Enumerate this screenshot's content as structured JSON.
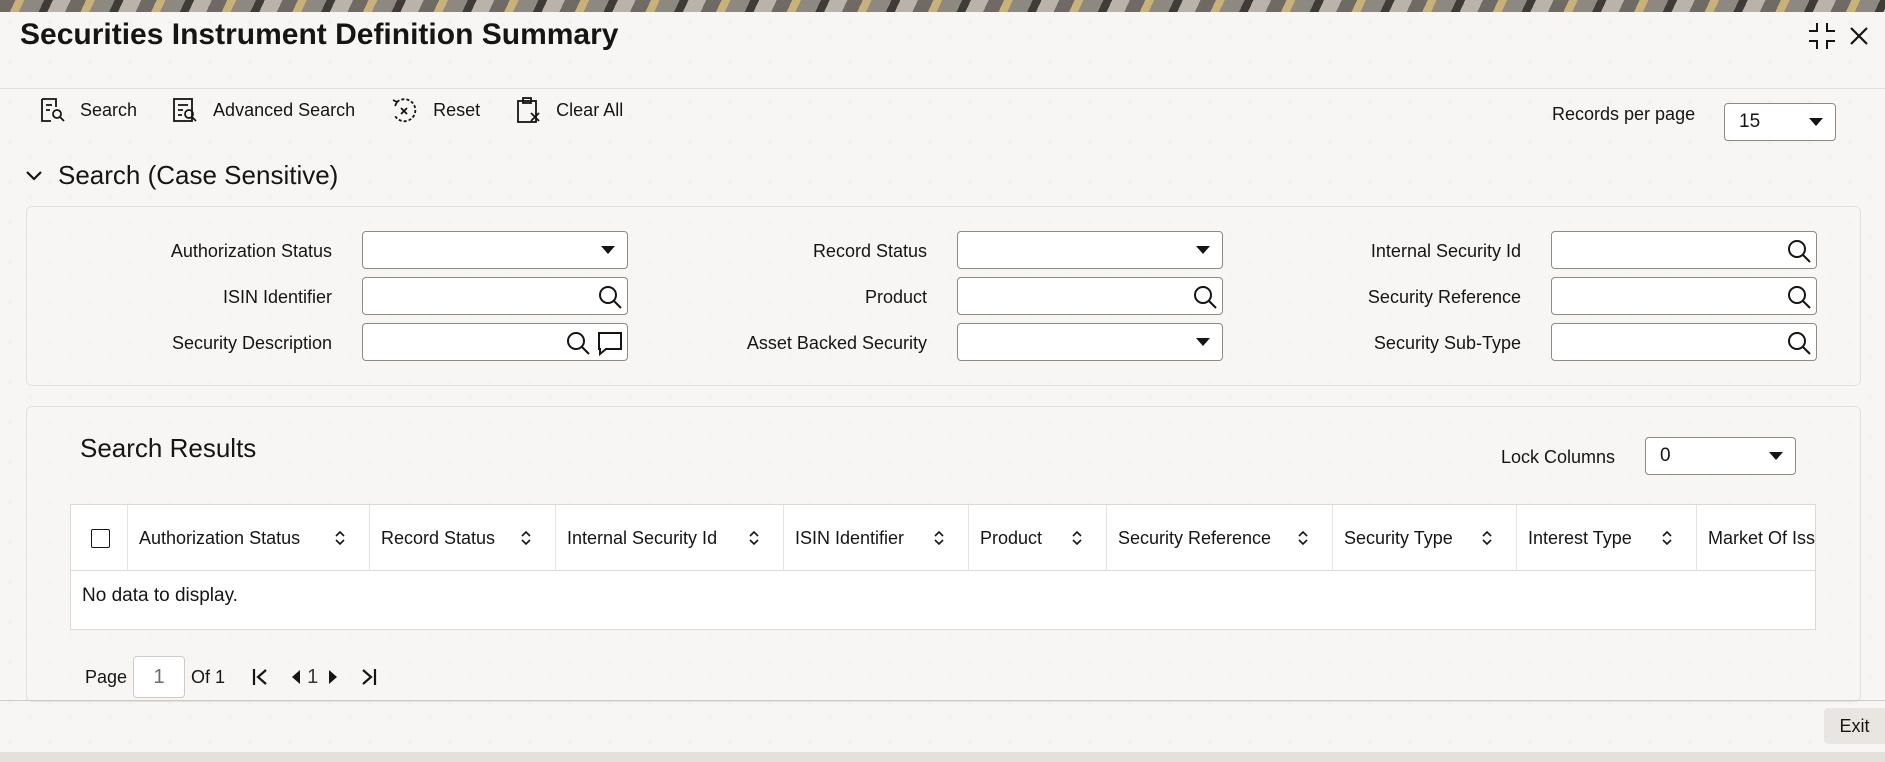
{
  "window": {
    "title": "Securities Instrument Definition Summary"
  },
  "toolbar": {
    "search_label": "Search",
    "advanced_search_label": "Advanced Search",
    "reset_label": "Reset",
    "clear_all_label": "Clear All",
    "records_per_page_label": "Records per page",
    "records_per_page_value": "15"
  },
  "search": {
    "section_title": "Search (Case Sensitive)",
    "fields": {
      "authorization_status": "Authorization Status",
      "record_status": "Record Status",
      "internal_security_id": "Internal Security Id",
      "isin_identifier": "ISIN Identifier",
      "product": "Product",
      "security_reference": "Security Reference",
      "security_description": "Security Description",
      "asset_backed_security": "Asset Backed Security",
      "security_sub_type": "Security Sub-Type"
    }
  },
  "results": {
    "title": "Search Results",
    "lock_columns_label": "Lock Columns",
    "lock_columns_value": "0",
    "columns": [
      "Authorization Status",
      "Record Status",
      "Internal Security Id",
      "ISIN Identifier",
      "Product",
      "Security Reference",
      "Security Type",
      "Interest Type",
      "Market Of Issu"
    ],
    "empty_message": "No data to display."
  },
  "pager": {
    "page_label": "Page",
    "page_value": "1",
    "of_label": "Of 1",
    "current_page": "1"
  },
  "footer": {
    "exit_label": "Exit"
  }
}
